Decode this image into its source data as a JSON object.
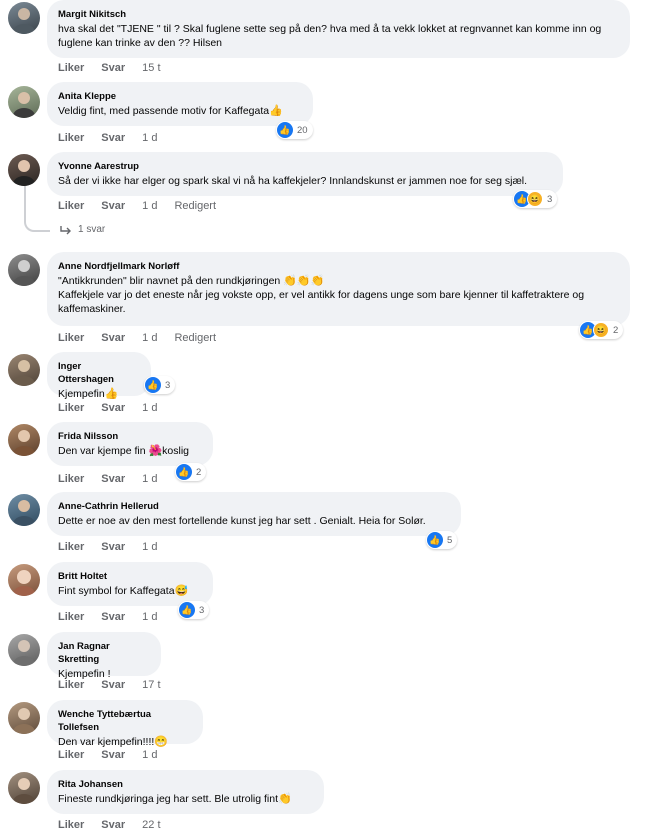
{
  "colors": {
    "bubble": "#f0f2f5",
    "meta": "#65676b",
    "like": "#1877f2",
    "haha": "#f7b125"
  },
  "actions": {
    "like": "Liker",
    "reply": "Svar"
  },
  "comments": [
    {
      "author": "Margit Nikitsch",
      "text": "hva skal det \"TJENE \" til ? Skal fuglene sette seg på den? hva med å ta vekk lokket at regnvannet kan komme inn og fuglene kan trinke av den ?? Hilsen",
      "time": "15 t",
      "edited": "",
      "reactions": ""
    },
    {
      "author": "Anita Kleppe",
      "text": "Veldig fint, med passende motiv for Kaffegata",
      "time": "1 d",
      "edited": "",
      "reactions": "20"
    },
    {
      "author": "Yvonne Aarestrup",
      "text": "Så der vi ikke har elger og spark skal vi nå ha kaffekjeler? Innlandskunst er jammen noe for seg sjæl.",
      "time": "1 d",
      "edited": "Redigert",
      "reactions": "3",
      "replies": "1 svar"
    },
    {
      "author": "Anne Nordfjellmark Norløff",
      "text": "\"Antikkrunden\" blir navnet på den rundkjøringen",
      "text2": "Kaffekjele var jo det eneste når jeg vokste opp, er vel antikk for dagens unge som bare kjenner til kaffetraktere og kaffemaskiner.",
      "time": "1 d",
      "edited": "Redigert",
      "reactions": "2"
    },
    {
      "author": "Inger Ottershagen",
      "text": "Kjempefin",
      "time": "1 d",
      "edited": "",
      "reactions": "3"
    },
    {
      "author": "Frida Nilsson",
      "text": "Den var kjempe fin",
      "text_after": "koslig",
      "time": "1 d",
      "edited": "",
      "reactions": "2"
    },
    {
      "author": "Anne-Cathrin Hellerud",
      "text": "Dette er noe av den mest fortellende kunst jeg har sett . Genialt. Heia for Solør.",
      "time": "1 d",
      "edited": "",
      "reactions": "5"
    },
    {
      "author": "Britt Holtet",
      "text": "Fint symbol for Kaffegata",
      "time": "1 d",
      "edited": "",
      "reactions": "3"
    },
    {
      "author": "Jan Ragnar Skretting",
      "text": "Kjempefin !",
      "time": "17 t",
      "edited": "",
      "reactions": ""
    },
    {
      "author": "Wenche Tyttebærtua Tollefsen",
      "text": "Den var kjempefin!!!!",
      "time": "1 d",
      "edited": "",
      "reactions": ""
    },
    {
      "author": "Rita Johansen",
      "text": "Fineste rundkjøringa jeg har sett. Ble utrolig fint",
      "time": "22 t",
      "edited": "",
      "reactions": ""
    }
  ]
}
